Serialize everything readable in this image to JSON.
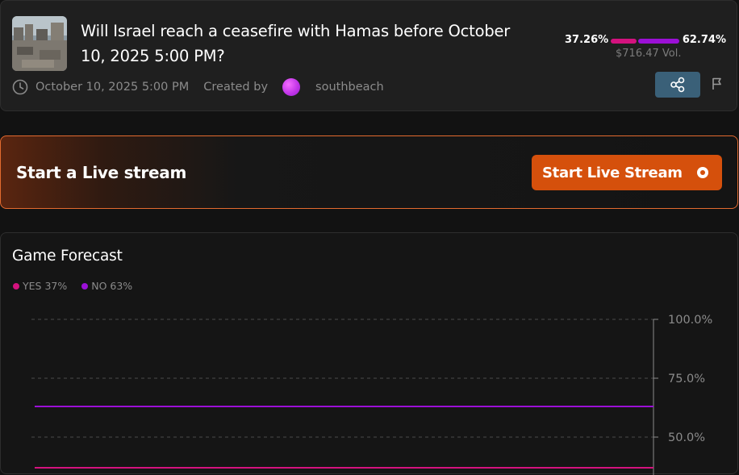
{
  "market": {
    "title": "Will Israel reach a ceasefire with Hamas before October 10, 2025 5:00 PM?",
    "end_date": "October 10, 2025 5:00 PM",
    "created_by_label": "Created by",
    "creator": "southbeach",
    "yes_pct": "37.26%",
    "no_pct": "62.74%",
    "yes_fraction": 0.3726,
    "volume": "$716.47 Vol.",
    "icons": {
      "clock": "clock-icon",
      "share": "share-icon",
      "flag": "flag-icon"
    }
  },
  "live": {
    "title": "Start a Live stream",
    "button_label": "Start Live Stream"
  },
  "forecast": {
    "title": "Game Forecast",
    "legend": [
      {
        "label": "YES 37%",
        "color": "#d4127e"
      },
      {
        "label": "NO 63%",
        "color": "#9b10d6"
      }
    ]
  },
  "chart_data": {
    "type": "line",
    "title": "Game Forecast",
    "y_tick_labels": [
      "100.0%",
      "75.0%",
      "50.0%"
    ],
    "ylim": [
      37,
      100
    ],
    "grid": true,
    "legend_position": "top-left",
    "series": [
      {
        "name": "YES 37%",
        "color": "#d4127e",
        "values": [
          37,
          37
        ]
      },
      {
        "name": "NO 63%",
        "color": "#9b10d6",
        "values": [
          63,
          63
        ]
      }
    ]
  },
  "colors": {
    "accent_orange": "#d5500c",
    "yes": "#d4127e",
    "no": "#9b10d6",
    "share_button": "#3a6078"
  }
}
